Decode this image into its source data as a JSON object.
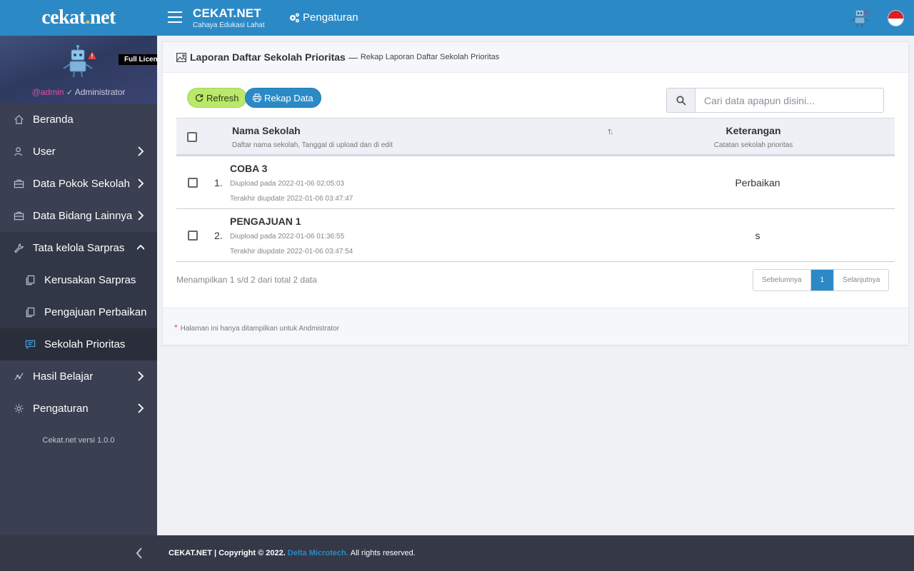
{
  "brand": {
    "name_part1": "cekat",
    "name_dot": ".",
    "name_part2": "net"
  },
  "profile": {
    "license": "Full License",
    "username": "@admin",
    "role": "Administrator"
  },
  "sidebar": {
    "items": [
      {
        "label": "Beranda",
        "icon": "home-icon"
      },
      {
        "label": "User",
        "icon": "user-icon"
      },
      {
        "label": "Data Pokok Sekolah",
        "icon": "briefcase-icon"
      },
      {
        "label": "Data Bidang Lainnya",
        "icon": "briefcase-icon"
      },
      {
        "label": "Tata kelola Sarpras",
        "icon": "wrench-icon"
      },
      {
        "label": "Kerusakan Sarpras",
        "icon": "clipboard-icon"
      },
      {
        "label": "Pengajuan Perbaikan",
        "icon": "clipboard-icon"
      },
      {
        "label": "Sekolah Prioritas",
        "icon": "message-icon"
      },
      {
        "label": "Hasil Belajar",
        "icon": "chart-icon"
      },
      {
        "label": "Pengaturan",
        "icon": "gear-icon"
      }
    ],
    "version": "Cekat.net versi 1.0.0"
  },
  "header": {
    "title": "CEKAT.NET",
    "subtitle": "Cahaya Edukasi Lahat",
    "settings_label": "Pengaturan"
  },
  "page": {
    "title": "Laporan Daftar Sekolah Prioritas",
    "dash": "—",
    "subtitle": "Rekap Laporan Daftar Sekolah Prioritas",
    "refresh_label": "Refresh",
    "rekap_label": "Rekap Data",
    "search_placeholder": "Cari data apapun disini..."
  },
  "table": {
    "columns": {
      "name": "Nama Sekolah",
      "name_sub": "Daftar nama sekolah, Tanggal di upload dan di edit",
      "ket": "Keterangan",
      "ket_sub": "Catatan sekolah prioritas"
    },
    "rows": [
      {
        "num": "1.",
        "name": "COBA 3",
        "uploaded": "Diupload pada 2022-01-06 02:05:03",
        "updated": "Terakhir diupdate 2022-01-06 03:47:47",
        "ket": "Perbaikan"
      },
      {
        "num": "2.",
        "name": "PENGAJUAN 1",
        "uploaded": "Diupload pada 2022-01-06 01:36:55",
        "updated": "Terakhir diupdate 2022-01-06 03:47:54",
        "ket": "s"
      }
    ],
    "showing": "Menampilkan 1 s/d 2 dari total 2 data",
    "pager": {
      "prev": "Sebelumnya",
      "current": "1",
      "next": "Selanjutnya"
    }
  },
  "note": {
    "star": "*",
    "text": "Halaman ini hanya ditampilkan untuk Andmistrator"
  },
  "footer": {
    "prefix": "CEKAT.NET | Copyright © 2022.",
    "link": "Delta Microtech.",
    "suffix": "All rights reserved."
  }
}
